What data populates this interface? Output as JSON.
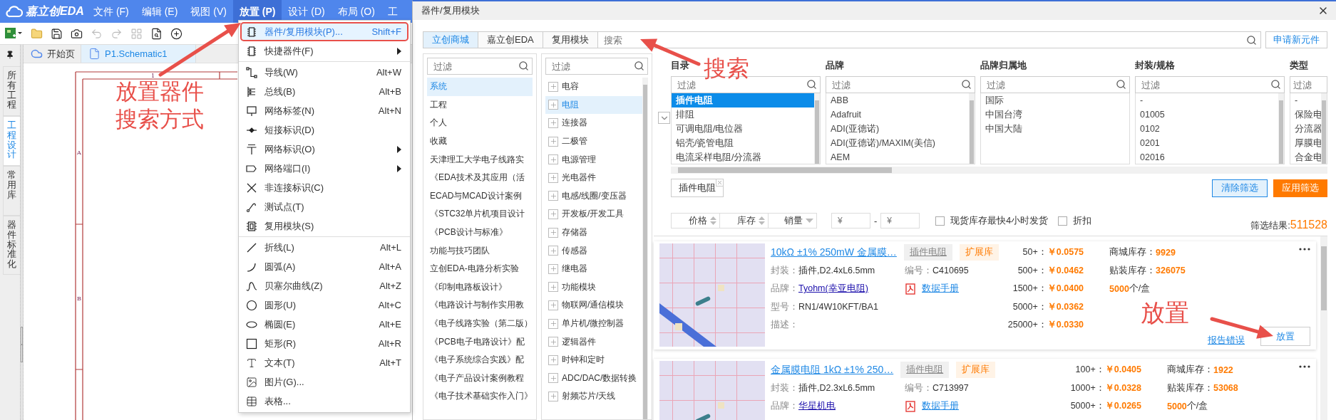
{
  "app": {
    "logo": "嘉立创EDA",
    "menu": [
      {
        "label": "文件 (F)",
        "selected": false
      },
      {
        "label": "编辑 (E)",
        "selected": false
      },
      {
        "label": "视图 (V)",
        "selected": false
      },
      {
        "label": "放置 (P)",
        "selected": true
      },
      {
        "label": "设计 (D)",
        "selected": false
      },
      {
        "label": "布局 (O)",
        "selected": false
      },
      {
        "label": "工",
        "selected": false
      }
    ],
    "toolbar": [
      {
        "kind": "new",
        "disabled": false
      },
      {
        "kind": "open",
        "disabled": false
      },
      {
        "kind": "save",
        "disabled": false
      },
      {
        "kind": "snapshot",
        "disabled": false
      },
      {
        "kind": "undo",
        "disabled": true
      },
      {
        "kind": "redo",
        "disabled": true
      },
      {
        "kind": "grid",
        "disabled": true
      },
      {
        "kind": "find",
        "disabled": false
      },
      {
        "kind": "zoom_in",
        "disabled": false
      }
    ],
    "sidebar": [
      {
        "label": "所有工程",
        "selected": false
      },
      {
        "label": "工程设计",
        "selected": true
      },
      {
        "label": "常用库",
        "selected": false
      },
      {
        "label": "器件标准化",
        "selected": false
      }
    ],
    "doc_tabs": [
      {
        "kind": "home",
        "label": "开始页",
        "selected": false
      },
      {
        "kind": "file",
        "label": "P1.Schematic1",
        "selected": true
      }
    ],
    "frame_labels": [
      "1",
      "A",
      "B"
    ]
  },
  "place_menu": [
    {
      "kind": "item",
      "label": "器件/复用模块(P)...",
      "shortcut": "Shift+F",
      "submenu": false,
      "highlighted": true
    },
    {
      "kind": "item",
      "label": "快捷器件(F)",
      "submenu": true,
      "highlighted": false
    },
    {
      "kind": "separator"
    },
    {
      "kind": "item",
      "label": "导线(W)",
      "shortcut": "Alt+W",
      "submenu": false,
      "highlighted": false
    },
    {
      "kind": "item",
      "label": "总线(B)",
      "shortcut": "Alt+B",
      "submenu": false,
      "highlighted": false
    },
    {
      "kind": "item",
      "label": "网络标签(N)",
      "shortcut": "Alt+N",
      "submenu": false,
      "highlighted": false
    },
    {
      "kind": "item",
      "label": "短接标识(D)",
      "submenu": false,
      "highlighted": false
    },
    {
      "kind": "item",
      "label": "网络标识(O)",
      "submenu": true,
      "highlighted": false
    },
    {
      "kind": "item",
      "label": "网络端口(I)",
      "submenu": true,
      "highlighted": false
    },
    {
      "kind": "item",
      "label": "非连接标识(C)",
      "submenu": false,
      "highlighted": false
    },
    {
      "kind": "item",
      "label": "测试点(T)",
      "submenu": false,
      "highlighted": false
    },
    {
      "kind": "item",
      "label": "复用模块(S)",
      "submenu": false,
      "highlighted": false
    },
    {
      "kind": "separator"
    },
    {
      "kind": "item",
      "label": "折线(L)",
      "shortcut": "Alt+L",
      "submenu": false,
      "highlighted": false
    },
    {
      "kind": "item",
      "label": "圆弧(A)",
      "shortcut": "Alt+A",
      "submenu": false,
      "highlighted": false
    },
    {
      "kind": "item",
      "label": "贝塞尔曲线(Z)",
      "shortcut": "Alt+Z",
      "submenu": false,
      "highlighted": false
    },
    {
      "kind": "item",
      "label": "圆形(U)",
      "shortcut": "Alt+C",
      "submenu": false,
      "highlighted": false
    },
    {
      "kind": "item",
      "label": "椭圆(E)",
      "shortcut": "Alt+E",
      "submenu": false,
      "highlighted": false
    },
    {
      "kind": "item",
      "label": "矩形(R)",
      "shortcut": "Alt+R",
      "submenu": false,
      "highlighted": false
    },
    {
      "kind": "item",
      "label": "文本(T)",
      "shortcut": "Alt+T",
      "submenu": false,
      "highlighted": false
    },
    {
      "kind": "item",
      "label": "图片(G)...",
      "submenu": false,
      "highlighted": false
    },
    {
      "kind": "item",
      "label": "表格...",
      "submenu": false,
      "highlighted": false
    }
  ],
  "dialog": {
    "title": "器件/复用模块",
    "source_tabs": [
      {
        "label": "立创商城",
        "selected": true
      },
      {
        "label": "嘉立创EDA",
        "selected": false
      },
      {
        "label": "复用模块",
        "selected": false
      }
    ],
    "search": {
      "placeholder": "搜索"
    },
    "new_part_button": "申请新元件",
    "libraries": {
      "filter_placeholder": "过滤",
      "items": [
        {
          "label": "系统",
          "selected": true
        },
        {
          "label": "工程",
          "selected": false
        },
        {
          "label": "个人",
          "selected": false
        },
        {
          "label": "收藏",
          "selected": false
        },
        {
          "label": "天津理工大学电子线路实",
          "selected": false
        },
        {
          "label": "《EDA技术及其应用（活",
          "selected": false
        },
        {
          "label": "ECAD与MCAD设计案例",
          "selected": false
        },
        {
          "label": "《STC32单片机项目设计",
          "selected": false
        },
        {
          "label": "《PCB设计与标准》",
          "selected": false
        },
        {
          "label": "功能与技巧团队",
          "selected": false
        },
        {
          "label": "立创EDA-电路分析实验",
          "selected": false
        },
        {
          "label": "《印制电路板设计》",
          "selected": false
        },
        {
          "label": "《电路设计与制作实用教",
          "selected": false
        },
        {
          "label": "《电子线路实验（第二版）",
          "selected": false
        },
        {
          "label": "《PCB电子电路设计》配",
          "selected": false
        },
        {
          "label": "《电子系统综合实践》配",
          "selected": false
        },
        {
          "label": "《电子产品设计案例教程",
          "selected": false
        },
        {
          "label": "《电子技术基础实作入门》",
          "selected": false
        }
      ]
    },
    "categories": {
      "filter_placeholder": "过滤",
      "items": [
        {
          "label": "电容",
          "selected": false
        },
        {
          "label": "电阻",
          "selected": true
        },
        {
          "label": "连接器",
          "selected": false
        },
        {
          "label": "二极管",
          "selected": false
        },
        {
          "label": "电源管理",
          "selected": false
        },
        {
          "label": "光电器件",
          "selected": false
        },
        {
          "label": "电感/线圈/变压器",
          "selected": false
        },
        {
          "label": "开发板/开发工具",
          "selected": false
        },
        {
          "label": "存储器",
          "selected": false
        },
        {
          "label": "传感器",
          "selected": false
        },
        {
          "label": "继电器",
          "selected": false
        },
        {
          "label": "功能模块",
          "selected": false
        },
        {
          "label": "物联网/通信模块",
          "selected": false
        },
        {
          "label": "单片机/微控制器",
          "selected": false
        },
        {
          "label": "逻辑器件",
          "selected": false
        },
        {
          "label": "时钟和定时",
          "selected": false
        },
        {
          "label": "ADC/DAC/数据转换",
          "selected": false
        },
        {
          "label": "射频芯片/天线",
          "selected": false
        }
      ]
    },
    "facets": [
      {
        "title": "目录",
        "filter_placeholder": "过滤",
        "options": [
          {
            "label": "插件电阻",
            "selected": true
          },
          {
            "label": "排阻",
            "selected": false
          },
          {
            "label": "可调电阻/电位器",
            "selected": false
          },
          {
            "label": "铝壳/瓷管电阻",
            "selected": false
          },
          {
            "label": "电流采样电阻/分流器",
            "selected": false
          }
        ]
      },
      {
        "title": "品牌",
        "filter_placeholder": "过滤",
        "options": [
          {
            "label": "ABB",
            "selected": false
          },
          {
            "label": "Adafruit",
            "selected": false
          },
          {
            "label": "ADI(亚德诺)",
            "selected": false
          },
          {
            "label": "ADI(亚德诺)/MAXIM(美信)",
            "selected": false
          },
          {
            "label": "AEM",
            "selected": false
          }
        ]
      },
      {
        "title": "品牌归属地",
        "filter_placeholder": "过滤",
        "options": [
          {
            "label": "国际",
            "selected": false
          },
          {
            "label": "中国台湾",
            "selected": false
          },
          {
            "label": "中国大陆",
            "selected": false
          }
        ]
      },
      {
        "title": "封装/规格",
        "filter_placeholder": "过滤",
        "options": [
          {
            "label": "-",
            "selected": false
          },
          {
            "label": "01005",
            "selected": false
          },
          {
            "label": "0102",
            "selected": false
          },
          {
            "label": "0201",
            "selected": false
          },
          {
            "label": "02016",
            "selected": false
          }
        ]
      },
      {
        "title": "类型",
        "filter_placeholder": "过滤",
        "options": [
          {
            "label": "-",
            "selected": false
          },
          {
            "label": "保险电",
            "selected": false
          },
          {
            "label": "分流器",
            "selected": false
          },
          {
            "label": "厚膜电",
            "selected": false
          },
          {
            "label": "合金电",
            "selected": false
          }
        ]
      }
    ],
    "active_tags": [
      "插件电阻"
    ],
    "clear_button": "清除筛选",
    "apply_button": "应用筛选",
    "sort": [
      {
        "label": "价格",
        "kind": "both"
      },
      {
        "label": "库存",
        "kind": "both"
      },
      {
        "label": "销量",
        "kind": "down"
      }
    ],
    "price_min": {
      "placeholder": "¥"
    },
    "price_separator": "-",
    "price_max": {
      "placeholder": "¥"
    },
    "checkboxes": [
      {
        "label": "现货库存最快4小时发货",
        "checked": false
      },
      {
        "label": "折扣",
        "checked": false
      }
    ],
    "result_label": "筛选结果:",
    "result_count": "511528",
    "products": [
      {
        "title": "10kΩ ±1% 250mW 金属膜…",
        "tags": [
          {
            "label": "插件电阻",
            "kind": "category"
          },
          {
            "label": "扩展库",
            "kind": "library"
          }
        ],
        "fields": [
          {
            "label": "封装：",
            "value": "插件,D2.4xL6.5mm",
            "kind": "text"
          },
          {
            "label": "编号：",
            "value": "C410695",
            "kind": "text"
          },
          {
            "label": "品牌：",
            "value": "Tyohm(幸亚电阻)",
            "kind": "link"
          },
          {
            "label": "数据手册",
            "kind": "datasheet"
          },
          {
            "label": "型号：",
            "value": "RN1/4W10KFT/BA1",
            "kind": "text"
          },
          {
            "label": "描述：",
            "kind": "text"
          }
        ],
        "prices": [
          {
            "qty": "50+：",
            "price": "￥0.0575"
          },
          {
            "qty": "500+：",
            "price": "￥0.0462"
          },
          {
            "qty": "1500+：",
            "price": "￥0.0400"
          },
          {
            "qty": "5000+：",
            "price": "￥0.0362"
          },
          {
            "qty": "25000+：",
            "price": "￥0.0330"
          }
        ],
        "stock": [
          {
            "label": "商城库存：",
            "value": "9929"
          },
          {
            "label": "贴装库存：",
            "value": "326075"
          }
        ],
        "pack": "5000",
        "pack_unit": "个/盒",
        "report": "报告错误",
        "place": "放置"
      },
      {
        "title": "金属膜电阻 1kΩ ±1% 250…",
        "tags": [
          {
            "label": "插件电阻",
            "kind": "category"
          },
          {
            "label": "扩展库",
            "kind": "library"
          }
        ],
        "fields": [
          {
            "label": "封装：",
            "value": "插件,D2.3xL6.5mm",
            "kind": "text"
          },
          {
            "label": "编号：",
            "value": "C713997",
            "kind": "text"
          },
          {
            "label": "品牌：",
            "value": "华星机电",
            "kind": "link"
          },
          {
            "label": "数据手册",
            "kind": "datasheet"
          }
        ],
        "prices": [
          {
            "qty": "100+：",
            "price": "￥0.0405"
          },
          {
            "qty": "1000+：",
            "price": "￥0.0328"
          },
          {
            "qty": "5000+：",
            "price": "￥0.0265"
          }
        ],
        "stock": [
          {
            "label": "商城库存：",
            "value": "1922"
          },
          {
            "label": "贴装库存：",
            "value": "53068"
          }
        ],
        "pack": "5000",
        "pack_unit": "个/盒"
      }
    ]
  },
  "annotations": [
    {
      "text": "放置器件搜索方式"
    },
    {
      "text": "搜索"
    },
    {
      "text": "放置"
    }
  ]
}
